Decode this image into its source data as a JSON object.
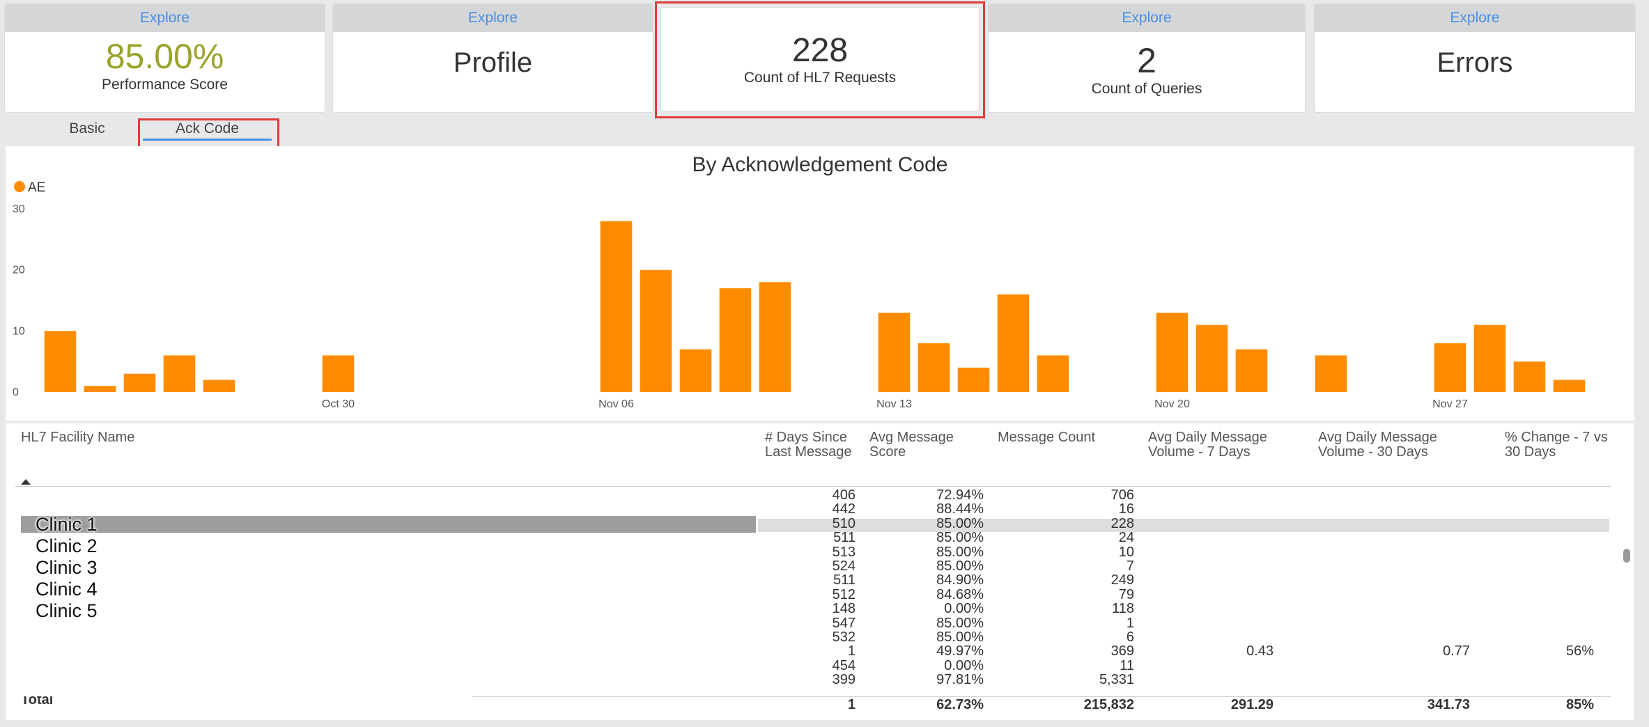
{
  "cards": [
    {
      "explore": "Explore",
      "title": "85.00%",
      "subtitle": "Performance Score",
      "title_color": "#9aa32a"
    },
    {
      "explore": "Explore",
      "title": "Profile",
      "subtitle": ""
    },
    {
      "explore": "",
      "title": "228",
      "subtitle": "Count of HL7 Requests"
    },
    {
      "explore": "Explore",
      "title": "2",
      "subtitle": "Count of Queries"
    },
    {
      "explore": "Explore",
      "title": "Errors",
      "subtitle": ""
    }
  ],
  "tabs": {
    "basic": "Basic",
    "ack_code": "Ack Code"
  },
  "chart_data": {
    "type": "bar",
    "title": "By Acknowledgement Code",
    "legend": "AE",
    "color": "#ff8c00",
    "ylim": [
      0,
      30
    ],
    "y_ticks": [
      "0",
      "10",
      "20",
      "30"
    ],
    "x_ticks": [
      "Oct 30",
      "Nov 06",
      "Nov 13",
      "Nov 20",
      "Nov 27"
    ],
    "categories": [
      "Oct 23",
      "Oct 24",
      "Oct 25",
      "Oct 26",
      "Oct 27",
      "Oct 28",
      "Oct 29",
      "Oct 30",
      "Oct 31",
      "Nov 01",
      "Nov 02",
      "Nov 03",
      "Nov 04",
      "Nov 05",
      "Nov 06",
      "Nov 07",
      "Nov 08",
      "Nov 09",
      "Nov 10",
      "Nov 11",
      "Nov 12",
      "Nov 13",
      "Nov 14",
      "Nov 15",
      "Nov 16",
      "Nov 17",
      "Nov 18",
      "Nov 19",
      "Nov 20",
      "Nov 21",
      "Nov 22",
      "Nov 23",
      "Nov 24",
      "Nov 25",
      "Nov 26",
      "Nov 27",
      "Nov 28",
      "Nov 29",
      "Nov 30",
      "Dec 01"
    ],
    "series": [
      {
        "values": [
          10,
          1,
          3,
          6,
          2,
          0,
          0,
          6,
          0,
          0,
          0,
          0,
          0,
          0,
          28,
          20,
          7,
          17,
          18,
          0,
          0,
          13,
          8,
          4,
          16,
          6,
          0,
          0,
          13,
          11,
          7,
          0,
          6,
          0,
          0,
          8,
          11,
          5,
          2,
          0
        ]
      }
    ]
  },
  "table": {
    "headers": [
      "HL7 Facility Name",
      "# Days Since Last Message",
      "Avg Message Score",
      "Message Count",
      "Avg Daily Message Volume - 7 Days",
      "Avg Daily Message Volume - 30 Days",
      "% Change - 7 vs 30 Days"
    ],
    "facilities": [
      "Clinic 1",
      "Clinic 2",
      "Clinic 3",
      "Clinic 4",
      "Clinic 5"
    ],
    "rows": [
      [
        "406",
        "72.94%",
        "706",
        "",
        "",
        ""
      ],
      [
        "442",
        "88.44%",
        "16",
        "",
        "",
        ""
      ],
      [
        "510",
        "85.00%",
        "228",
        "",
        "",
        ""
      ],
      [
        "511",
        "85.00%",
        "24",
        "",
        "",
        ""
      ],
      [
        "513",
        "85.00%",
        "10",
        "",
        "",
        ""
      ],
      [
        "524",
        "85.00%",
        "7",
        "",
        "",
        ""
      ],
      [
        "511",
        "84.90%",
        "249",
        "",
        "",
        ""
      ],
      [
        "512",
        "84.68%",
        "79",
        "",
        "",
        ""
      ],
      [
        "148",
        "0.00%",
        "118",
        "",
        "",
        ""
      ],
      [
        "547",
        "85.00%",
        "1",
        "",
        "",
        ""
      ],
      [
        "532",
        "85.00%",
        "6",
        "",
        "",
        ""
      ],
      [
        "1",
        "49.97%",
        "369",
        "0.43",
        "0.77",
        "56%"
      ],
      [
        "454",
        "0.00%",
        "11",
        "",
        "",
        ""
      ],
      [
        "399",
        "97.81%",
        "5,331",
        "",
        "",
        ""
      ]
    ],
    "total": {
      "label": "Total",
      "values": [
        "1",
        "62.73%",
        "215,832",
        "291.29",
        "341.73",
        "85%"
      ]
    }
  }
}
